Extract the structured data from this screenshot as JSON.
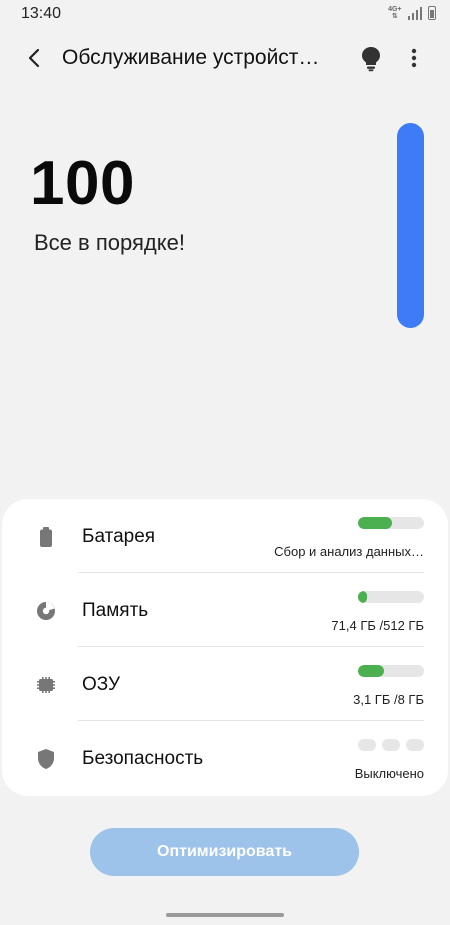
{
  "status_bar": {
    "time": "13:40",
    "network": "4G+",
    "icons": [
      "signal-icon",
      "battery-icon"
    ]
  },
  "header": {
    "title": "Обслуживание устройст…",
    "icons": [
      "back-icon",
      "lightbulb-icon",
      "more-vert-icon"
    ]
  },
  "score": {
    "value": "100",
    "status": "Все в порядке!",
    "level_fraction": 1.0,
    "color": "#3e7bf6"
  },
  "items": [
    {
      "label": "Батарея",
      "detail": "Сбор и анализ данных…",
      "meter": 0.52,
      "icon": "battery-icon"
    },
    {
      "label": "Память",
      "detail": "71,4 ГБ /512 ГБ",
      "meter": 0.14,
      "icon": "storage-pie-icon"
    },
    {
      "label": "ОЗУ",
      "detail": "3,1 ГБ /8 ГБ",
      "meter": 0.39,
      "icon": "ram-chip-icon"
    },
    {
      "label": "Безопасность",
      "detail": "Выключено",
      "meter": null,
      "icon": "shield-icon"
    }
  ],
  "colors": {
    "meter_fill": "#4caf50",
    "button": "#9dc3ea"
  },
  "optimize_button": {
    "label": "Оптимизировать"
  }
}
